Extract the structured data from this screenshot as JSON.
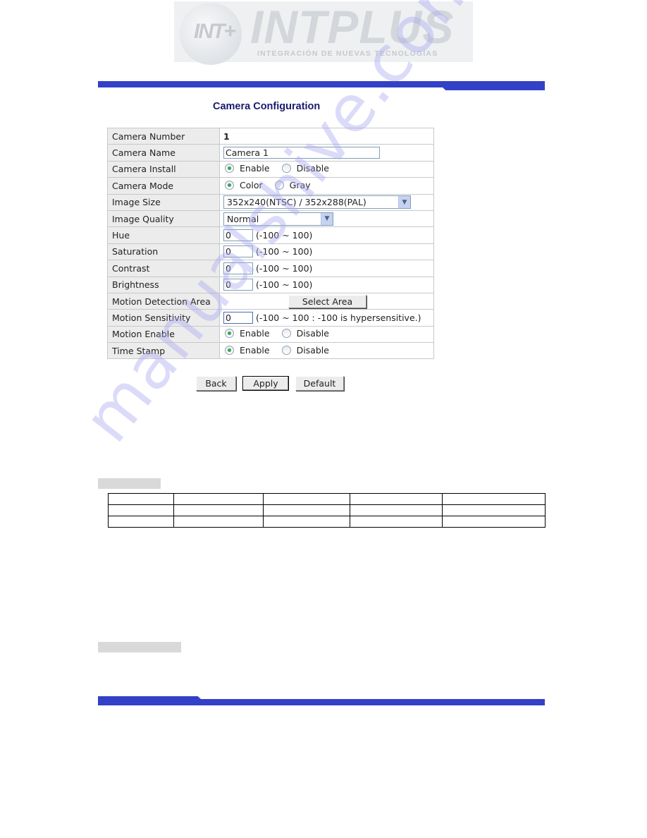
{
  "header": {
    "logo": {
      "badge_text": "INT+",
      "brand": "INTPLUS",
      "tagline": "INTEGRACIÓN DE NUEVAS TECNOLOGÍAS"
    },
    "accent_color": "#3340c8"
  },
  "page": {
    "title": "Camera Configuration"
  },
  "form": {
    "camera_number": {
      "label": "Camera Number",
      "value": "1"
    },
    "camera_name": {
      "label": "Camera Name",
      "value": "Camera 1"
    },
    "camera_install": {
      "label": "Camera Install",
      "options": [
        "Enable",
        "Disable"
      ],
      "selected": "Enable"
    },
    "camera_mode": {
      "label": "Camera Mode",
      "options": [
        "Color",
        "Gray"
      ],
      "selected": "Color"
    },
    "image_size": {
      "label": "Image Size",
      "selected": "352x240(NTSC) / 352x288(PAL)"
    },
    "image_quality": {
      "label": "Image Quality",
      "selected": "Normal"
    },
    "hue": {
      "label": "Hue",
      "value": "0",
      "range": "(-100 ~ 100)"
    },
    "saturation": {
      "label": "Saturation",
      "value": "0",
      "range": "(-100 ~ 100)"
    },
    "contrast": {
      "label": "Contrast",
      "value": "0",
      "range": "(-100 ~ 100)"
    },
    "brightness": {
      "label": "Brightness",
      "value": "0",
      "range": "(-100 ~ 100)"
    },
    "motion_detection_area": {
      "label": "Motion Detection Area",
      "button": "Select Area"
    },
    "motion_sensitivity": {
      "label": "Motion Sensitivity",
      "value": "0",
      "range": "(-100 ~ 100 : -100 is hypersensitive.)"
    },
    "motion_enable": {
      "label": "Motion Enable",
      "options": [
        "Enable",
        "Disable"
      ],
      "selected": "Enable"
    },
    "time_stamp": {
      "label": "Time Stamp",
      "options": [
        "Enable",
        "Disable"
      ],
      "selected": "Enable"
    }
  },
  "actions": {
    "back": "Back",
    "apply": "Apply",
    "default": "Default"
  },
  "empty_table": {
    "rows": 3,
    "columns": 5
  },
  "watermark": {
    "text": "manualshive.com"
  }
}
